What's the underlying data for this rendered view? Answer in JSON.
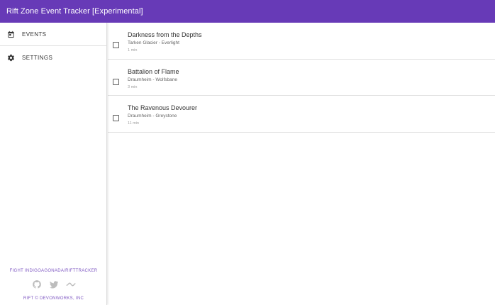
{
  "appbar": {
    "title": "Rift Zone Event Tracker [Experimental]"
  },
  "sidebar": {
    "items": [
      {
        "label": "EVENTS",
        "icon": "calendar-icon"
      },
      {
        "label": "SETTINGS",
        "icon": "gear-icon"
      }
    ],
    "footer": {
      "link": "FIGHT INDIGOAGONADA/RIFTTRACKER",
      "social": [
        "github-icon",
        "twitter-icon",
        "trend-icon"
      ],
      "copyright": "RIFT © DEVONWORKS, INC"
    }
  },
  "events": [
    {
      "title": "Darkness from the Depths",
      "location": "Tarken Glacier - Everlight",
      "time": "1 min"
    },
    {
      "title": "Battalion of Flame",
      "location": "Draumheim - Wolfsbane",
      "time": "3 min"
    },
    {
      "title": "The Ravenous Devourer",
      "location": "Draumheim - Greystone",
      "time": "11 min"
    }
  ],
  "colors": {
    "appbar": "#673ab7",
    "accent": "#7e57c2"
  }
}
